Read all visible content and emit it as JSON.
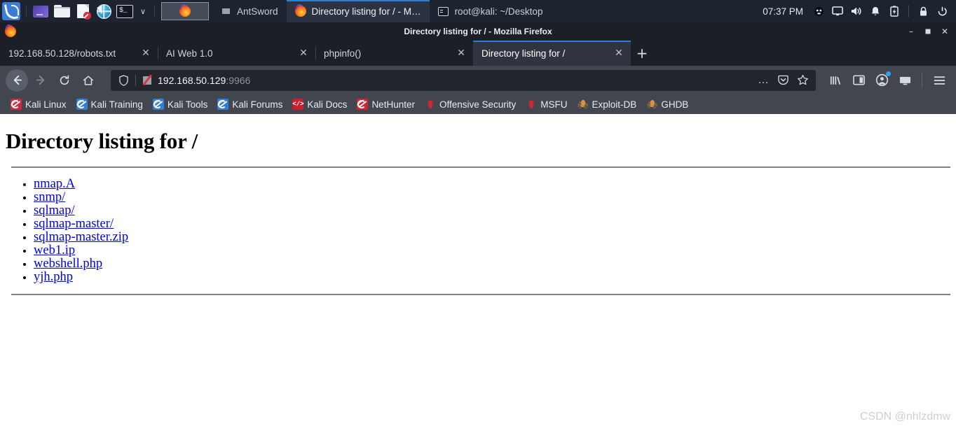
{
  "taskbar": {
    "launcher": "kali-menu",
    "quick_launch": [
      {
        "name": "workspace-switcher-icon",
        "label": "Workspace"
      },
      {
        "name": "file-manager-icon",
        "label": "File Manager"
      },
      {
        "name": "text-editor-icon",
        "label": "Text Editor"
      },
      {
        "name": "web-browser-icon",
        "label": "Web Browser"
      },
      {
        "name": "terminal-icon",
        "label": "Terminal"
      }
    ],
    "chevron": "∨",
    "windows": [
      {
        "name": "taskbar-window-antsword",
        "icon": "window-icon",
        "label": "AntSword",
        "active": false
      },
      {
        "name": "taskbar-window-firefox",
        "icon": "firefox-icon",
        "label": "Directory listing for / - M…",
        "active": true
      },
      {
        "name": "taskbar-window-terminal",
        "icon": "terminal-icon",
        "label": "root@kali: ~/Desktop",
        "active": false
      }
    ],
    "clock": "07:37 PM",
    "tray": [
      {
        "name": "tray-user-icon",
        "glyph": "●"
      },
      {
        "name": "tray-display-icon",
        "glyph": "⬜"
      },
      {
        "name": "tray-volume-icon",
        "glyph": "🔊"
      },
      {
        "name": "tray-notification-icon",
        "glyph": "🔔"
      },
      {
        "name": "tray-battery-icon",
        "glyph": "🔋"
      },
      {
        "name": "tray-lock-icon",
        "glyph": "🔒"
      },
      {
        "name": "tray-power-icon",
        "glyph": "⏻"
      }
    ]
  },
  "browser": {
    "window_title": "Directory listing for / - Mozilla Firefox",
    "window_controls": {
      "minimize": "–",
      "maximize": "⬜",
      "close": "✕"
    },
    "tabs": [
      {
        "label": "192.168.50.128/robots.txt",
        "active": false,
        "close": "✕"
      },
      {
        "label": "AI Web 1.0",
        "active": false,
        "close": "✕"
      },
      {
        "label": "phpinfo()",
        "active": false,
        "close": "✕"
      },
      {
        "label": "Directory listing for /",
        "active": true,
        "close": "✕"
      }
    ],
    "new_tab_label": "+",
    "nav": {
      "back": "←",
      "forward": "→",
      "reload": "↻",
      "home": "⌂"
    },
    "urlbar": {
      "host": "192.168.50.129",
      "port": ":9966",
      "shield_icon": "tracking-protection-shield",
      "security_icon": "insecure-connection-icon",
      "page_actions": "…",
      "pocket": "ⓥ",
      "bookmark_star": "☆"
    },
    "toolbar_right": {
      "library": "library-icon",
      "sidebar": "sidebar-icon",
      "account": "account-icon",
      "screenshot": "screenshot-icon",
      "menu": "≡"
    },
    "bookmarks": [
      {
        "label": "Kali Linux",
        "icon": "kali-red"
      },
      {
        "label": "Kali Training",
        "icon": "kali-blue"
      },
      {
        "label": "Kali Tools",
        "icon": "kali-blue"
      },
      {
        "label": "Kali Forums",
        "icon": "kali-blue"
      },
      {
        "label": "Kali Docs",
        "icon": "docs"
      },
      {
        "label": "NetHunter",
        "icon": "nethunter"
      },
      {
        "label": "Offensive Security",
        "icon": "dagger"
      },
      {
        "label": "MSFU",
        "icon": "dagger"
      },
      {
        "label": "Exploit-DB",
        "icon": "spider"
      },
      {
        "label": "GHDB",
        "icon": "spider"
      }
    ]
  },
  "page": {
    "title": "Directory listing for /",
    "entries": [
      {
        "label": "nmap.A"
      },
      {
        "label": "snmp/"
      },
      {
        "label": "sqlmap/"
      },
      {
        "label": "sqlmap-master/"
      },
      {
        "label": "sqlmap-master.zip"
      },
      {
        "label": "web1.ip"
      },
      {
        "label": "webshell.php"
      },
      {
        "label": "yjh.php"
      }
    ],
    "link_color": "#0000ee",
    "watermark": "CSDN @nhlzdmw"
  }
}
